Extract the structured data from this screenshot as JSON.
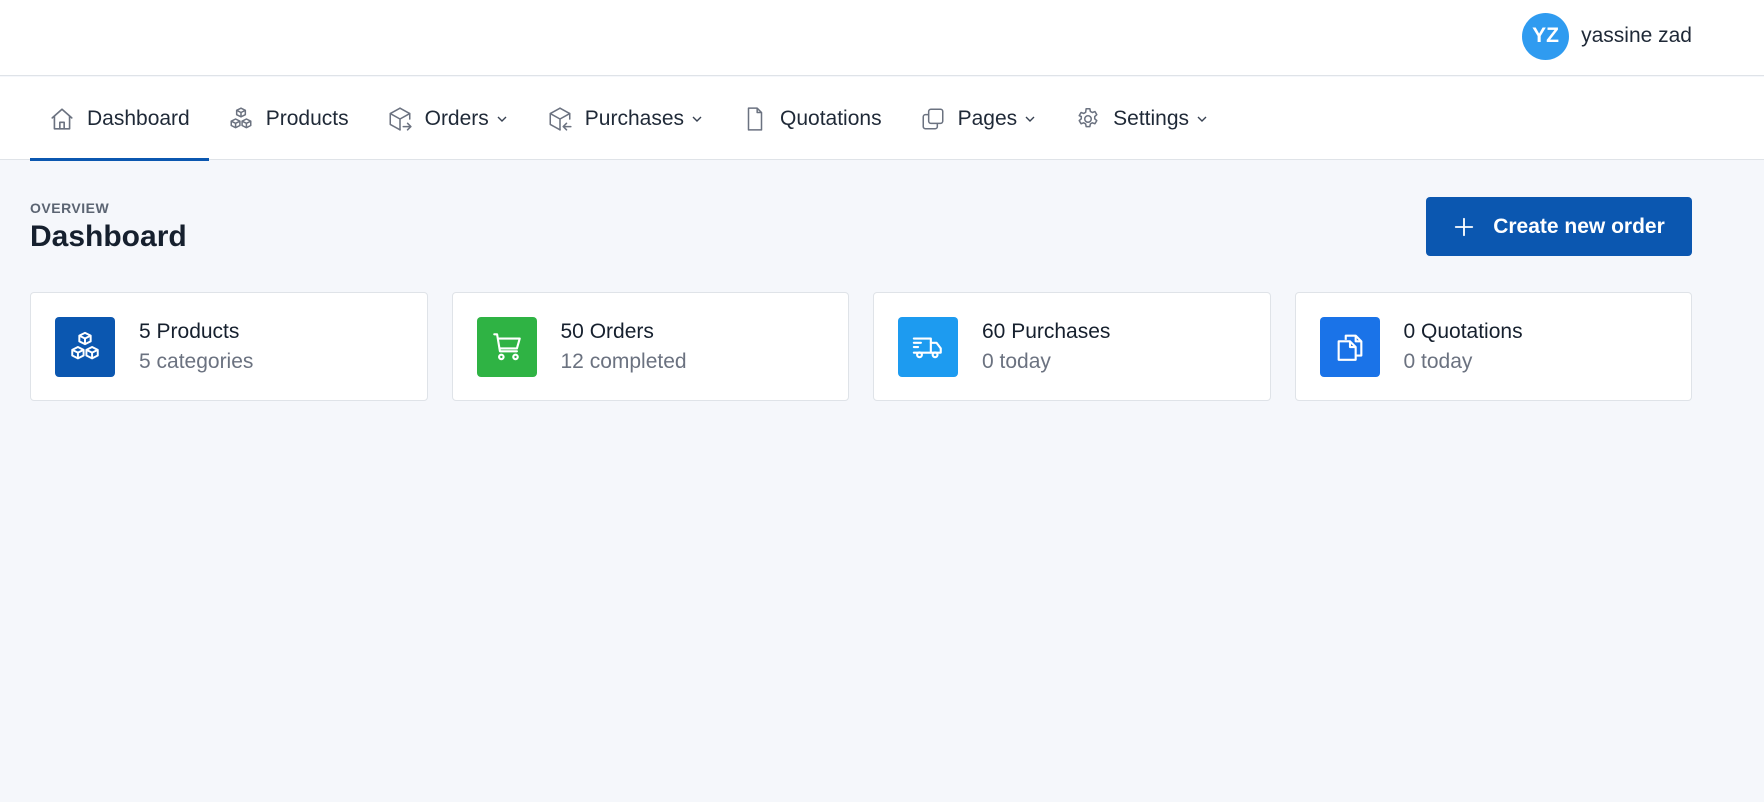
{
  "user": {
    "initials": "YZ",
    "name": "yassine zad",
    "avatar_color": "#2f9bf0"
  },
  "nav": {
    "items": [
      {
        "label": "Dashboard",
        "icon": "home-icon",
        "dropdown": false,
        "active": true
      },
      {
        "label": "Products",
        "icon": "boxes-icon",
        "dropdown": false,
        "active": false
      },
      {
        "label": "Orders",
        "icon": "box-out-icon",
        "dropdown": true,
        "active": false
      },
      {
        "label": "Purchases",
        "icon": "box-in-icon",
        "dropdown": true,
        "active": false
      },
      {
        "label": "Quotations",
        "icon": "file-icon",
        "dropdown": false,
        "active": false
      },
      {
        "label": "Pages",
        "icon": "copy-icon",
        "dropdown": true,
        "active": false
      },
      {
        "label": "Settings",
        "icon": "gear-icon",
        "dropdown": true,
        "active": false
      }
    ]
  },
  "header": {
    "overline": "OVERVIEW",
    "title": "Dashboard"
  },
  "actions": {
    "create_label": "Create new order"
  },
  "colors": {
    "primary": "#0b57b0",
    "green": "#2fb344",
    "sky": "#1d9bf0",
    "blue": "#1a73e8"
  },
  "cards": [
    {
      "title": "5 Products",
      "subtitle": "5 categories",
      "icon": "boxes-icon",
      "color": "#0b57b0"
    },
    {
      "title": "50 Orders",
      "subtitle": "12 completed",
      "icon": "cart-icon",
      "color": "#2fb344"
    },
    {
      "title": "60 Purchases",
      "subtitle": "0 today",
      "icon": "truck-icon",
      "color": "#1d9bf0"
    },
    {
      "title": "0 Quotations",
      "subtitle": "0 today",
      "icon": "copy-icon",
      "color": "#1a73e8"
    }
  ]
}
